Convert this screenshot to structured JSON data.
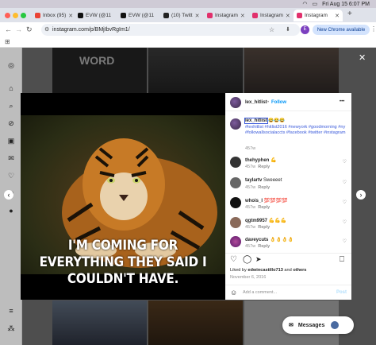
{
  "menubar": {
    "datetime": "Fri Aug 15  6:07 PM"
  },
  "tabs": [
    {
      "label": "Inbox (95)",
      "color": "#ea4335"
    },
    {
      "label": "EVW (@11",
      "color": "#111111"
    },
    {
      "label": "EVW (@11",
      "color": "#111111"
    },
    {
      "label": "(10) Twitt",
      "color": "#222222"
    },
    {
      "label": "Instagram",
      "color": "#e1306c"
    },
    {
      "label": "Instagram",
      "color": "#e1306c"
    },
    {
      "label": "Instagram",
      "color": "#e1306c"
    }
  ],
  "toolbar": {
    "url": "instagram.com/p/BMjIbvRgIm1/",
    "new_chrome": "New Chrome available",
    "profile_initial": "E"
  },
  "page": {
    "word_tile": "WORD",
    "close": "✕",
    "messages": "Messages"
  },
  "post": {
    "image_text": "I'M COMING FOR EVERYTHING THEY SAID I COULDN'T HAVE.",
    "author": "lex_hitlist",
    "follow": "Follow",
    "more": "•••",
    "caption_user": "lex_hitlist",
    "caption_emoji": "😂😂😂",
    "hashtags": "#lexhitlist #hitlist2016 #newyork #goodmorning #ny #followallsocialaccts #facebook #twitter #instagram",
    "caption_time": "457w",
    "comments": [
      {
        "user": "thehyphen",
        "text": "💪",
        "time": "457w",
        "reply": "Reply"
      },
      {
        "user": "taylartv",
        "text": "Sweeeet",
        "time": "457w",
        "reply": "Reply"
      },
      {
        "user": "whois_l",
        "text": "💯💯💯💯",
        "time": "457w",
        "reply": "Reply"
      },
      {
        "user": "qgtm9957",
        "text": "💪💪💪",
        "time": "457w",
        "reply": "Reply"
      },
      {
        "user": "daveycuts",
        "text": "👌👌👌👌",
        "time": "457w",
        "reply": "Reply"
      }
    ],
    "liked_prefix": "Liked by ",
    "liked_user": "edwincastillo713",
    "liked_and": " and ",
    "liked_others": "others",
    "date": "November 6, 2016",
    "add_comment_placeholder": "Add a comment...",
    "post_btn": "Post"
  },
  "colors": {
    "ig_blue": "#0095f6",
    "hashtag": "#00376b",
    "accent_hashtag": "#3b5bdb"
  }
}
